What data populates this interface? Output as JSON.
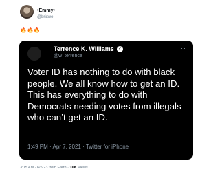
{
  "tweet": {
    "author_name": "•Emmy•",
    "author_handle": "@brixwe",
    "more_icon": "···",
    "body": "🔥🔥🔥",
    "time": "3:15 AM",
    "date": "6/5/23",
    "location": "from Earth",
    "views_count": "16K",
    "views_label": "Views"
  },
  "quoted_tweet": {
    "author_name": "Terrence K. Williams",
    "verified_icon": "check-badge-icon",
    "author_handle": "@w_terrence",
    "more_icon": "···",
    "text": "Voter ID has nothing to do with black people. We all know how to get an ID. This has everything to do with Democrats needing votes from illegals who can’t get an ID.",
    "time": "1:49 PM",
    "date": "Apr 7, 2021",
    "source": "Twitter for iPhone"
  },
  "colors": {
    "background": "#ffffff",
    "card": "#000000",
    "muted": "#657786",
    "fire": "#e25822"
  }
}
